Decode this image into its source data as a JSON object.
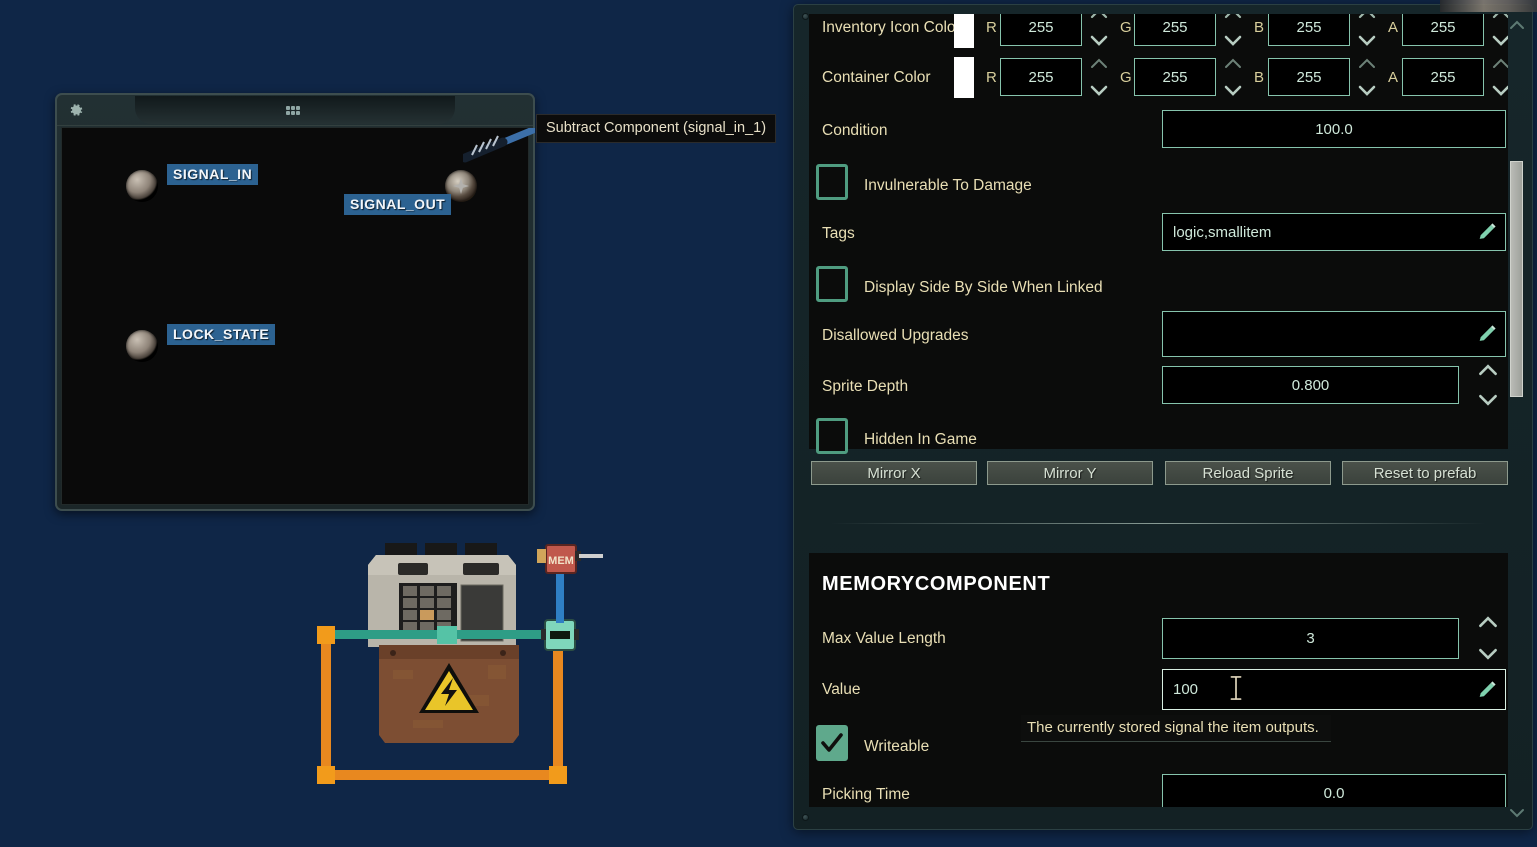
{
  "wiring_panel": {
    "gear_icon": "gear-icon",
    "grip_icon": "drag-grip-icon",
    "connections": [
      {
        "label": "SIGNAL_IN",
        "type": "input"
      },
      {
        "label": "SIGNAL_OUT",
        "type": "output"
      },
      {
        "label": "LOCK_STATE",
        "type": "input"
      }
    ]
  },
  "tooltip_component": "Subtract Component (signal_in_1)",
  "device": {
    "name": "electrical-cabinet-sprite",
    "memory_chip_label": "MEM",
    "hazard_icon": "electrical-hazard-icon"
  },
  "editor": {
    "rows": {
      "inventory_icon_color": {
        "label": "Inventory Icon Color",
        "swatch": "#ffffff",
        "channels": [
          {
            "name": "R",
            "value": "255"
          },
          {
            "name": "G",
            "value": "255"
          },
          {
            "name": "B",
            "value": "255"
          },
          {
            "name": "A",
            "value": "255"
          }
        ]
      },
      "container_color": {
        "label": "Container Color",
        "swatch": "#ffffff",
        "channels": [
          {
            "name": "R",
            "value": "255"
          },
          {
            "name": "G",
            "value": "255"
          },
          {
            "name": "B",
            "value": "255"
          },
          {
            "name": "A",
            "value": "255"
          }
        ]
      },
      "condition": {
        "label": "Condition",
        "value": "100.0"
      },
      "invulnerable_to_damage": {
        "label": "Invulnerable To Damage",
        "checked": false
      },
      "tags": {
        "label": "Tags",
        "value": "logic,smallitem"
      },
      "display_side_by_side": {
        "label": "Display Side By Side When Linked",
        "checked": false
      },
      "disallowed_upgrades": {
        "label": "Disallowed Upgrades",
        "value": ""
      },
      "sprite_depth": {
        "label": "Sprite Depth",
        "value": "0.800"
      },
      "hidden_in_game": {
        "label": "Hidden In Game",
        "checked": false
      }
    },
    "buttons": {
      "mirror_x": "Mirror X",
      "mirror_y": "Mirror Y",
      "reload_sprite": "Reload Sprite",
      "reset_to_prefab": "Reset to prefab"
    },
    "memory_component": {
      "title": "MEMORYCOMPONENT",
      "max_value_length": {
        "label": "Max Value Length",
        "value": "3"
      },
      "value": {
        "label": "Value",
        "value": "100"
      },
      "value_tooltip": "The currently stored signal the item outputs.",
      "writeable": {
        "label": "Writeable",
        "checked": true
      },
      "picking_time": {
        "label": "Picking Time",
        "value": "0.0"
      }
    }
  },
  "colors": {
    "background": "#0f2647",
    "panel_bg": "#16262a",
    "card_bg": "#0b0c0b",
    "field_border": "#86c4ad",
    "label_text": "#e9dfb5",
    "value_text": "#cfe8da",
    "checkbox_accent": "#5fa98c",
    "signal_label_bg": "#2c6291",
    "wire_orange": "#e8881f",
    "wire_teal": "#2e9d86",
    "wire_blue": "#2f7fc4"
  },
  "scrollbar": {
    "name": "editor-scrollbar",
    "up": "chevron-up-icon",
    "down": "chevron-down-icon"
  }
}
